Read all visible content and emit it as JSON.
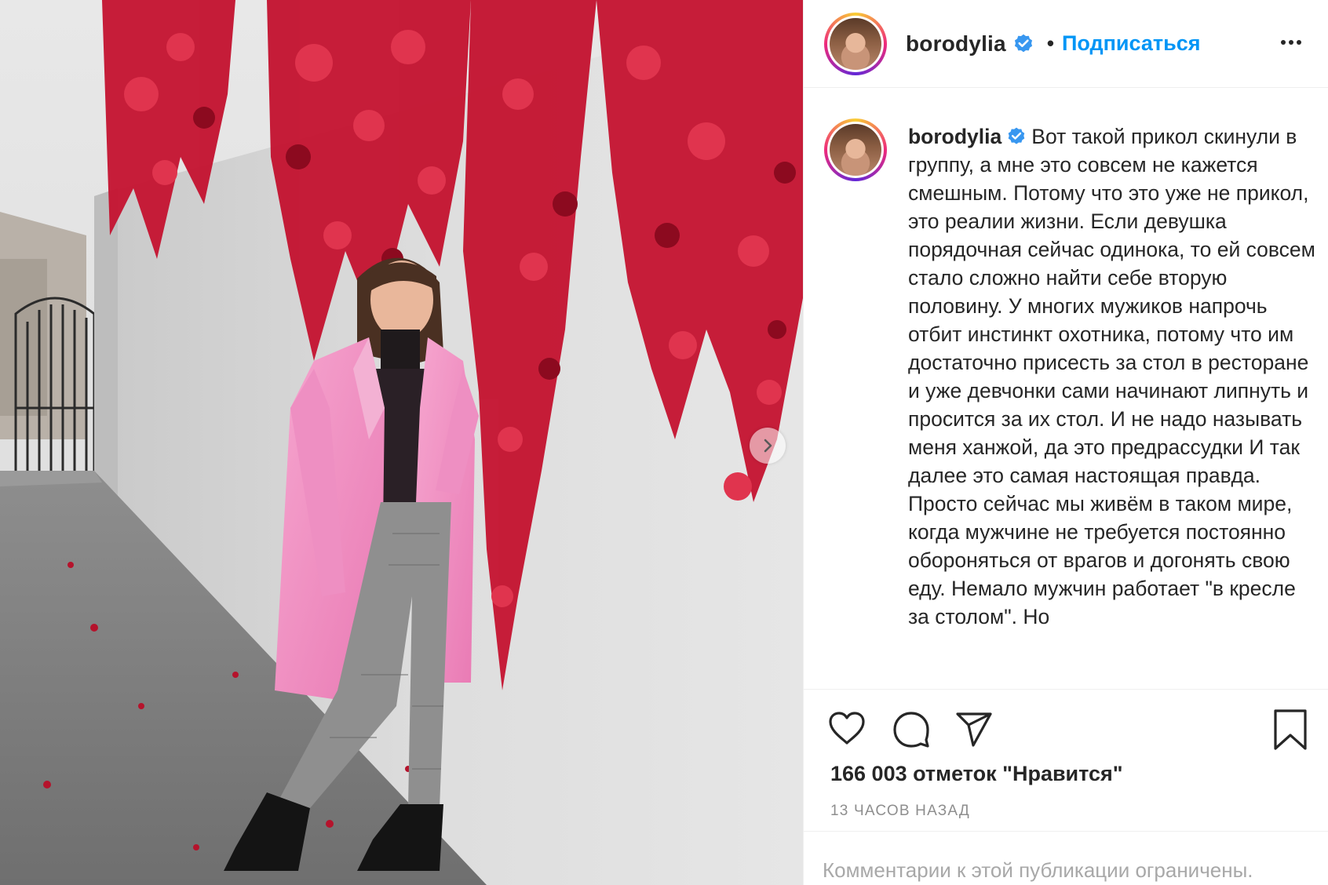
{
  "post": {
    "username": "borodylia",
    "verified": true,
    "separator": "•",
    "follow_label": "Подписаться",
    "more_icon": "more-horizontal-icon",
    "caption": "Вот такой прикол скинули в группу, а мне это совсем не кажется смешным. Потому что это уже не прикол, это реалии жизни. Если девушка порядочная сейчас одинока, то ей совсем стало сложно найти себе вторую половину. У многих мужиков напрочь отбит инстинкт охотника, потому что им достаточно присесть за стол в ресторане и уже девчонки сами начинают липнуть и просится за их стол. И не надо называть меня ханжой, да это предрассудки И так далее это самая настоящая правда. Просто сейчас мы живём в таком мире, когда мужчине не требуется постоянно обороняться от врагов и догонять свою еду. Немало мужчин работает \"в кресле за столом\". Но",
    "likes_text": "166 003 отметок \"Нравится\"",
    "time_ago": "13 ЧАСОВ НАЗАД",
    "comments_disabled_text": "Комментарии к этой публикации ограничены."
  },
  "actions": {
    "like_icon": "heart-icon",
    "comment_icon": "comment-icon",
    "share_icon": "send-icon",
    "save_icon": "bookmark-icon",
    "carousel_next_icon": "chevron-right-icon"
  },
  "colors": {
    "link_blue": "#0095f6",
    "verified_blue": "#3897f0",
    "text": "#262626",
    "secondary": "#8e8e8e",
    "coat_pink": "#f08cc0",
    "leaves_red": "#c4122f"
  }
}
